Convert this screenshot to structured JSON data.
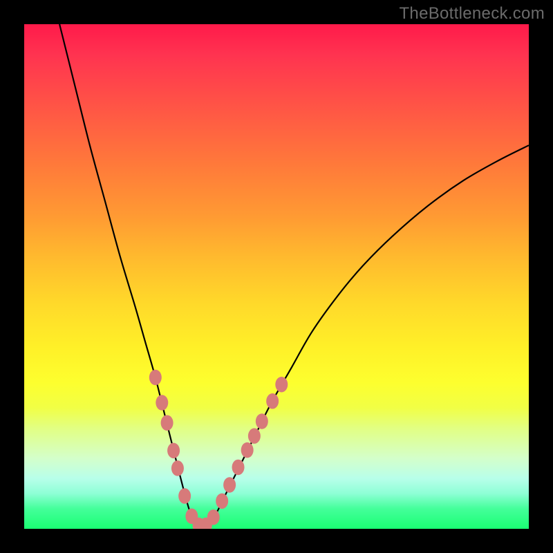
{
  "watermark": "TheBottleneck.com",
  "chart_data": {
    "type": "line",
    "title": "",
    "xlabel": "",
    "ylabel": "",
    "xlim": [
      0,
      100
    ],
    "ylim": [
      0,
      100
    ],
    "gradient_stops": [
      {
        "pos": 0,
        "color": "#ff1a4a"
      },
      {
        "pos": 6,
        "color": "#ff3350"
      },
      {
        "pos": 18,
        "color": "#ff5a44"
      },
      {
        "pos": 28,
        "color": "#ff7a3a"
      },
      {
        "pos": 38,
        "color": "#ff9a33"
      },
      {
        "pos": 46,
        "color": "#ffb92e"
      },
      {
        "pos": 55,
        "color": "#ffd82a"
      },
      {
        "pos": 64,
        "color": "#fff028"
      },
      {
        "pos": 71,
        "color": "#fdff2e"
      },
      {
        "pos": 76,
        "color": "#f1ff45"
      },
      {
        "pos": 80,
        "color": "#e2ff82"
      },
      {
        "pos": 86,
        "color": "#d4ffca"
      },
      {
        "pos": 90,
        "color": "#b8ffea"
      },
      {
        "pos": 93,
        "color": "#8effd6"
      },
      {
        "pos": 96,
        "color": "#44ff9a"
      },
      {
        "pos": 100,
        "color": "#1aff73"
      }
    ],
    "series": [
      {
        "name": "bottleneck-curve",
        "x": [
          7,
          10,
          13,
          16,
          19,
          22,
          24,
          26,
          28,
          30,
          31.8,
          33,
          34.5,
          36,
          38,
          40,
          43,
          46,
          49,
          53,
          57,
          62,
          67,
          73,
          80,
          87,
          94,
          100
        ],
        "y": [
          100,
          88,
          76,
          65,
          54,
          44,
          37,
          30,
          22,
          14,
          7,
          3,
          0.5,
          0.5,
          3,
          7,
          13,
          19,
          25,
          32,
          39,
          46,
          52,
          58,
          64,
          69,
          73,
          76
        ]
      }
    ],
    "markers": {
      "name": "data-markers",
      "color": "#d77a7a",
      "radius": 9,
      "points": [
        {
          "x": 26.0,
          "y": 30
        },
        {
          "x": 27.3,
          "y": 25
        },
        {
          "x": 28.3,
          "y": 21
        },
        {
          "x": 29.6,
          "y": 15.5
        },
        {
          "x": 30.4,
          "y": 12
        },
        {
          "x": 31.8,
          "y": 6.5
        },
        {
          "x": 33.2,
          "y": 2.5
        },
        {
          "x": 34.6,
          "y": 0.7
        },
        {
          "x": 36.0,
          "y": 0.7
        },
        {
          "x": 37.5,
          "y": 2.3
        },
        {
          "x": 39.2,
          "y": 5.5
        },
        {
          "x": 40.7,
          "y": 8.7
        },
        {
          "x": 42.4,
          "y": 12.2
        },
        {
          "x": 44.2,
          "y": 15.6
        },
        {
          "x": 45.6,
          "y": 18.4
        },
        {
          "x": 47.1,
          "y": 21.3
        },
        {
          "x": 49.2,
          "y": 25.3
        },
        {
          "x": 51.0,
          "y": 28.6
        }
      ]
    }
  }
}
